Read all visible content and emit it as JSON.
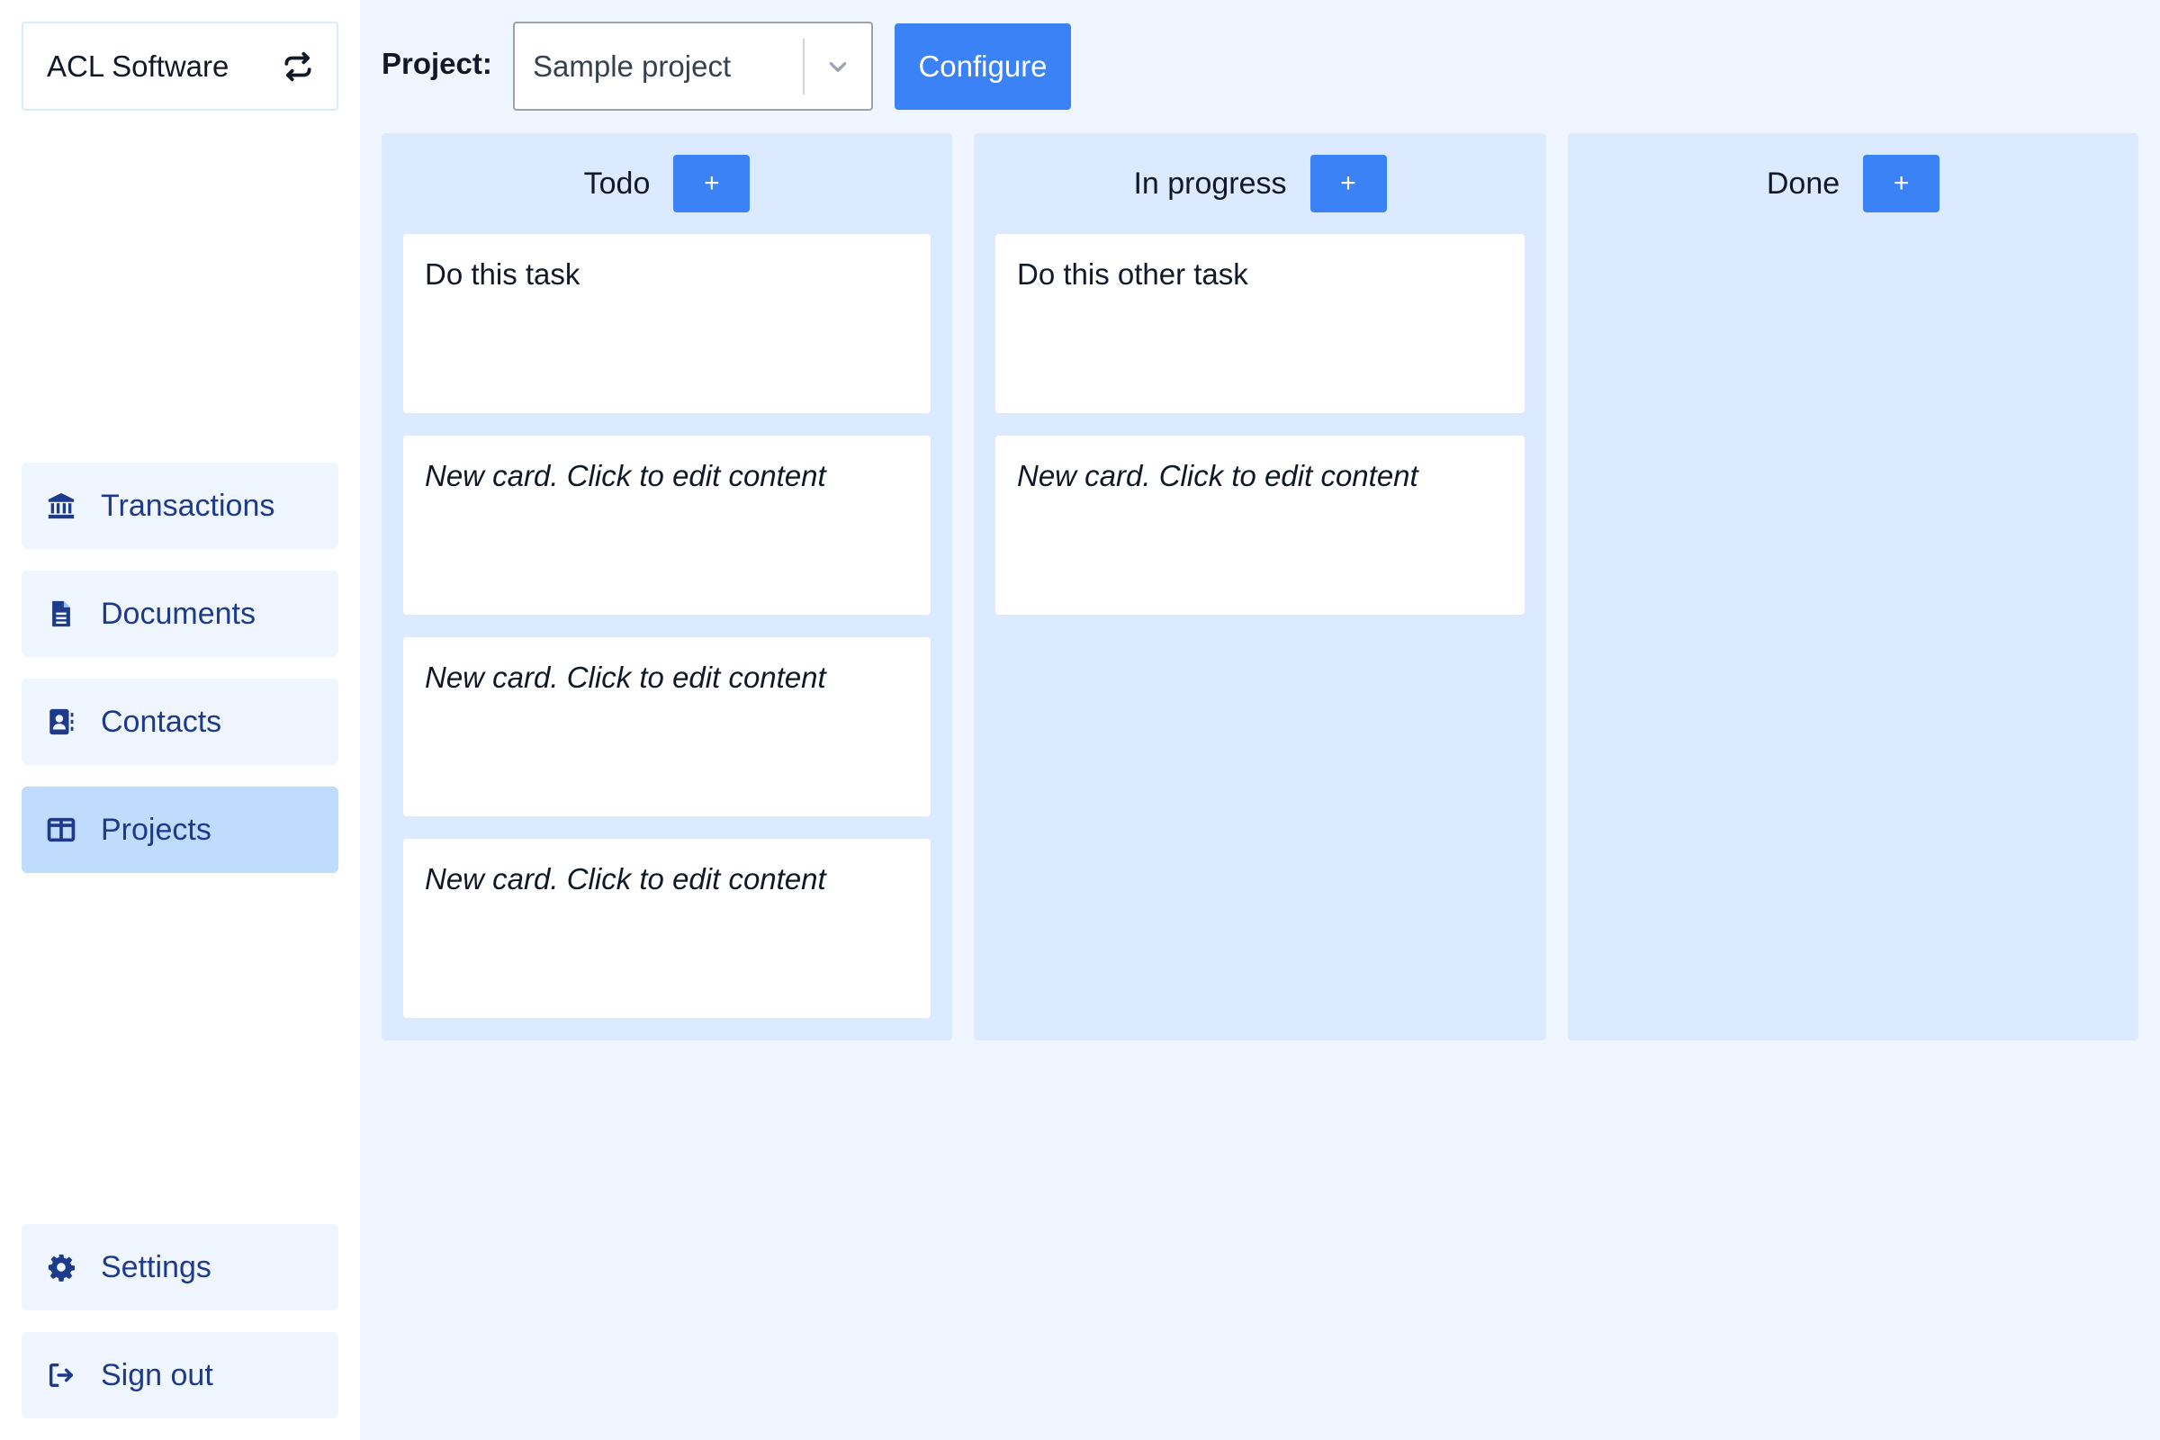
{
  "sidebar": {
    "org_name": "ACL Software",
    "items": [
      {
        "label": "Transactions",
        "icon": "bank-icon"
      },
      {
        "label": "Documents",
        "icon": "document-icon"
      },
      {
        "label": "Contacts",
        "icon": "contact-card-icon"
      },
      {
        "label": "Projects",
        "icon": "columns-icon",
        "active": true
      }
    ],
    "bottom_items": [
      {
        "label": "Settings",
        "icon": "gear-icon"
      },
      {
        "label": "Sign out",
        "icon": "sign-out-icon"
      }
    ]
  },
  "topbar": {
    "project_label": "Project:",
    "project_value": "Sample project",
    "configure_label": "Configure"
  },
  "board": {
    "add_label": "+",
    "columns": [
      {
        "title": "Todo",
        "cards": [
          {
            "text": "Do this task",
            "placeholder": false
          },
          {
            "text": "New card. Click to edit content",
            "placeholder": true
          },
          {
            "text": "New card. Click to edit content",
            "placeholder": true
          },
          {
            "text": "New card. Click to edit content",
            "placeholder": true
          }
        ]
      },
      {
        "title": "In progress",
        "cards": [
          {
            "text": "Do this other task",
            "placeholder": false
          },
          {
            "text": "New card. Click to edit content",
            "placeholder": true
          }
        ]
      },
      {
        "title": "Done",
        "cards": []
      }
    ]
  },
  "colors": {
    "accent": "#3b82f6",
    "background": "#eff6ff",
    "column": "#dbeafe",
    "nav_text": "#1e3a8a",
    "active_nav": "#bfdbfe"
  }
}
